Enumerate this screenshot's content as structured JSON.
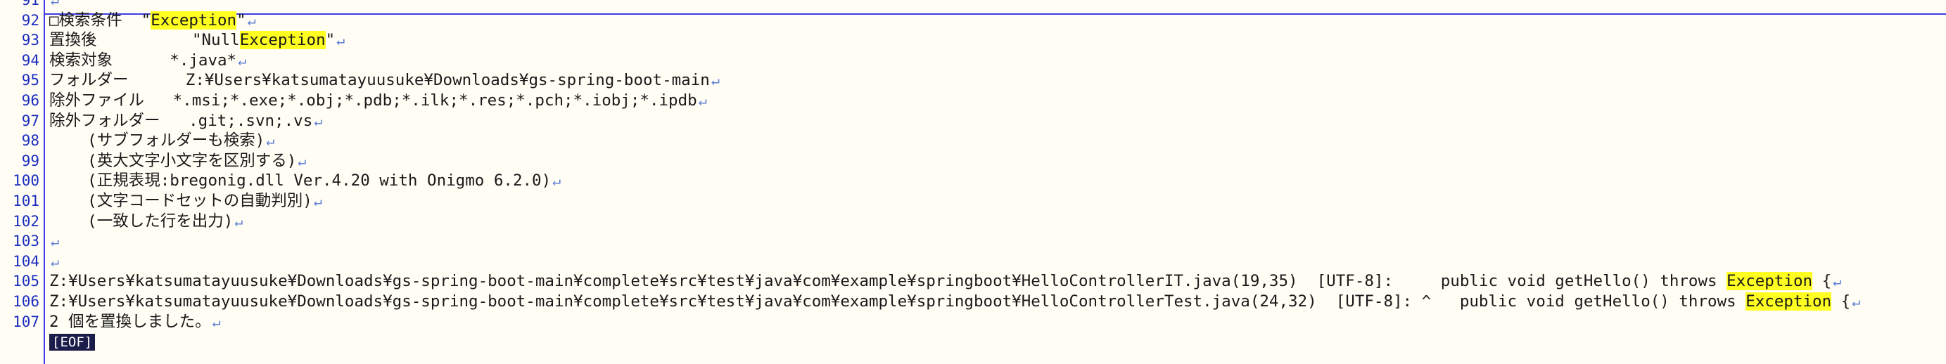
{
  "window": {
    "title": ""
  },
  "newline_glyph": "↵",
  "lines": [
    {
      "n": "91",
      "parts": [
        {
          "t": ""
        }
      ]
    },
    {
      "n": "92",
      "parts": [
        {
          "t": "□検索条件  \""
        },
        {
          "t": "Exception",
          "hl": true
        },
        {
          "t": "\""
        }
      ]
    },
    {
      "n": "93",
      "parts": [
        {
          "t": "置換後          \"Null"
        },
        {
          "t": "Exception",
          "hl": true
        },
        {
          "t": "\""
        }
      ]
    },
    {
      "n": "94",
      "parts": [
        {
          "t": "検索対象      *.java*"
        }
      ]
    },
    {
      "n": "95",
      "parts": [
        {
          "t": "フォルダー      Z:¥Users¥katsumatayuusuke¥Downloads¥gs-spring-boot-main"
        }
      ]
    },
    {
      "n": "96",
      "parts": [
        {
          "t": "除外ファイル   *.msi;*.exe;*.obj;*.pdb;*.ilk;*.res;*.pch;*.iobj;*.ipdb"
        }
      ]
    },
    {
      "n": "97",
      "parts": [
        {
          "t": "除外フォルダー   .git;.svn;.vs"
        }
      ]
    },
    {
      "n": "98",
      "parts": [
        {
          "t": "    (サブフォルダーも検索)"
        }
      ]
    },
    {
      "n": "99",
      "parts": [
        {
          "t": "    (英大文字小文字を区別する)"
        }
      ]
    },
    {
      "n": "100",
      "parts": [
        {
          "t": "    (正規表現:bregonig.dll Ver.4.20 with Onigmo 6.2.0)"
        }
      ]
    },
    {
      "n": "101",
      "parts": [
        {
          "t": "    (文字コードセットの自動判別)"
        }
      ]
    },
    {
      "n": "102",
      "parts": [
        {
          "t": "    (一致した行を出力)"
        }
      ]
    },
    {
      "n": "103",
      "parts": [
        {
          "t": ""
        }
      ]
    },
    {
      "n": "104",
      "parts": [
        {
          "t": ""
        }
      ]
    },
    {
      "n": "105",
      "parts": [
        {
          "t": "Z:¥Users¥katsumatayuusuke¥Downloads¥gs-spring-boot-main¥complete¥src¥test¥java¥com¥example¥springboot¥HelloControllerIT.java(19,35)  [UTF-8]:     public void getHello() throws "
        },
        {
          "t": "Exception",
          "hl": true
        },
        {
          "t": " {"
        }
      ]
    },
    {
      "n": "106",
      "parts": [
        {
          "t": "Z:¥Users¥katsumatayuusuke¥Downloads¥gs-spring-boot-main¥complete¥src¥test¥java¥com¥example¥springboot¥HelloControllerTest.java(24,32)  [UTF-8]: ^   public void getHello() throws "
        },
        {
          "t": "Exception",
          "hl": true
        },
        {
          "t": " {"
        }
      ]
    },
    {
      "n": "107",
      "parts": [
        {
          "t": "2 個を置換しました。"
        }
      ]
    }
  ],
  "eof_label": "[EOF]"
}
